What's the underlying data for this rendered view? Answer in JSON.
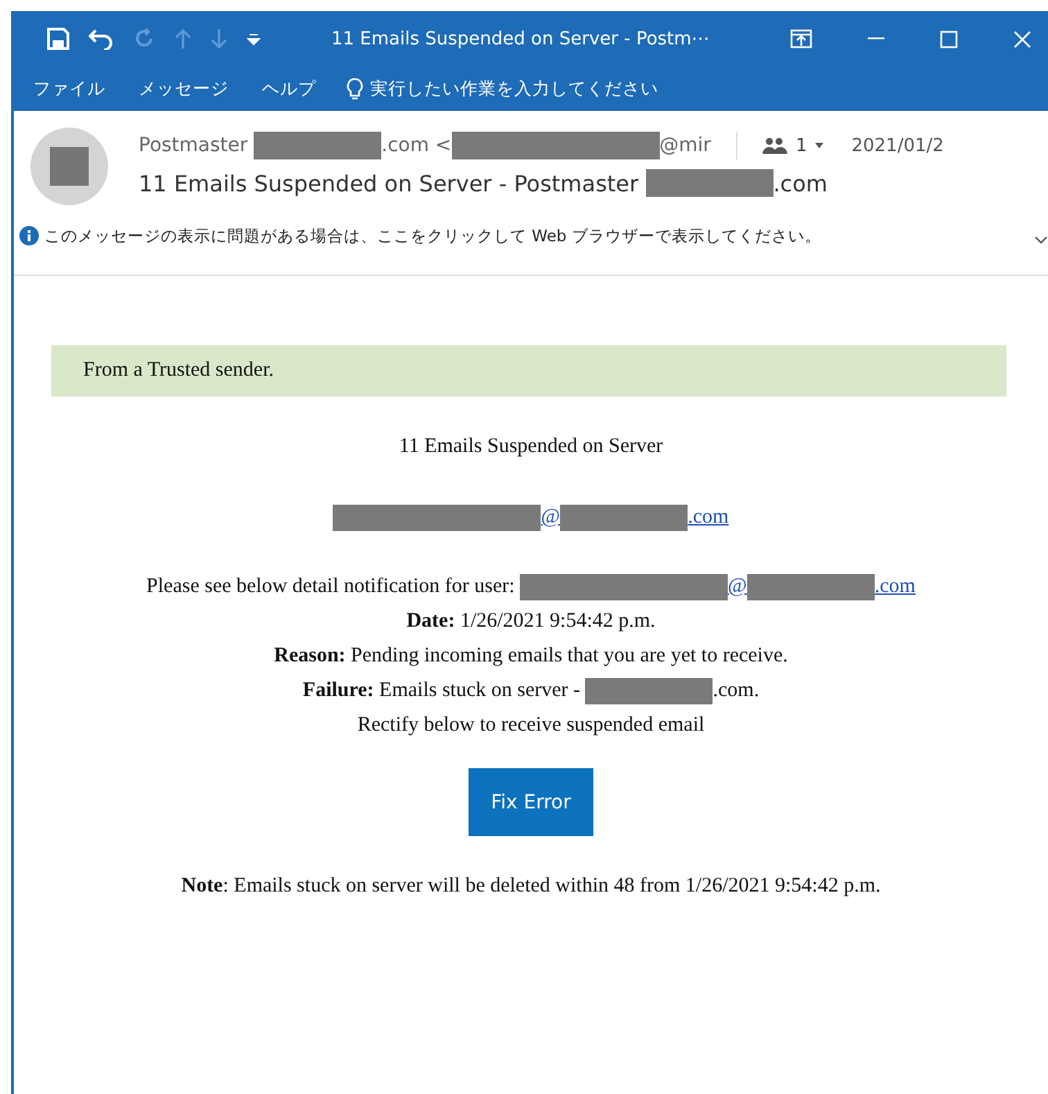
{
  "titlebar": {
    "title": "11 Emails Suspended on Server - Postm⋯",
    "quick_access": [
      {
        "kind": "save",
        "disabled": false
      },
      {
        "kind": "undo",
        "disabled": false
      },
      {
        "kind": "redo",
        "disabled": true
      },
      {
        "kind": "up",
        "disabled": true
      },
      {
        "kind": "down",
        "disabled": true
      },
      {
        "kind": "customize",
        "disabled": false
      }
    ]
  },
  "menu": {
    "items": [
      "ファイル",
      "メッセージ",
      "ヘルプ"
    ],
    "tell_me": "実行したい作業を入力してください"
  },
  "header": {
    "sender": [
      {
        "kind": "text",
        "text": "Postmaster "
      },
      {
        "kind": "redaction"
      },
      {
        "kind": "text",
        "text": ".com <"
      },
      {
        "kind": "long_redaction"
      },
      {
        "kind": "text",
        "text": "@mir"
      }
    ],
    "recipients": "1",
    "date": "2021/01/2",
    "subject": [
      {
        "kind": "text",
        "text": "11 Emails Suspended on Server - Postmaster "
      },
      {
        "kind": "redaction"
      },
      {
        "kind": "text",
        "text": ".com"
      }
    ],
    "info": "このメッセージの表示に問題がある場合は、ここをクリックして Web ブラウザーで表示してください。"
  },
  "body": {
    "banner": "From a Trusted sender.",
    "heading": "11 Emails Suspended on Server",
    "address": [
      {
        "kind": "long_redaction"
      },
      {
        "kind": "link",
        "text": "@"
      },
      {
        "kind": "redaction"
      },
      {
        "kind": "link",
        "text": ".com"
      }
    ],
    "lines": [
      [
        {
          "kind": "text",
          "text": "Please see below detail notification for user: "
        },
        {
          "kind": "long_redaction"
        },
        {
          "kind": "link",
          "text": "@"
        },
        {
          "kind": "redaction"
        },
        {
          "kind": "link",
          "text": ".com"
        }
      ],
      [
        {
          "kind": "bold",
          "text": "Date:"
        },
        {
          "kind": "text",
          "text": " 1/26/2021 9:54:42 p.m."
        }
      ],
      [
        {
          "kind": "bold",
          "text": "Reason:"
        },
        {
          "kind": "text",
          "text": " Pending incoming emails that you are yet to receive."
        }
      ],
      [
        {
          "kind": "bold",
          "text": "Failure:"
        },
        {
          "kind": "text",
          "text": " Emails stuck on server - "
        },
        {
          "kind": "redaction"
        },
        {
          "kind": "text",
          "text": ".com."
        }
      ],
      [
        {
          "kind": "text",
          "text": "Rectify below to receive suspended email"
        }
      ]
    ],
    "button": "Fix Error",
    "note": [
      {
        "kind": "bold",
        "text": "Note"
      },
      {
        "kind": "text",
        "text": ": Emails stuck on server will be deleted within 48 from 1/26/2021 9:54:42 p.m."
      }
    ]
  }
}
